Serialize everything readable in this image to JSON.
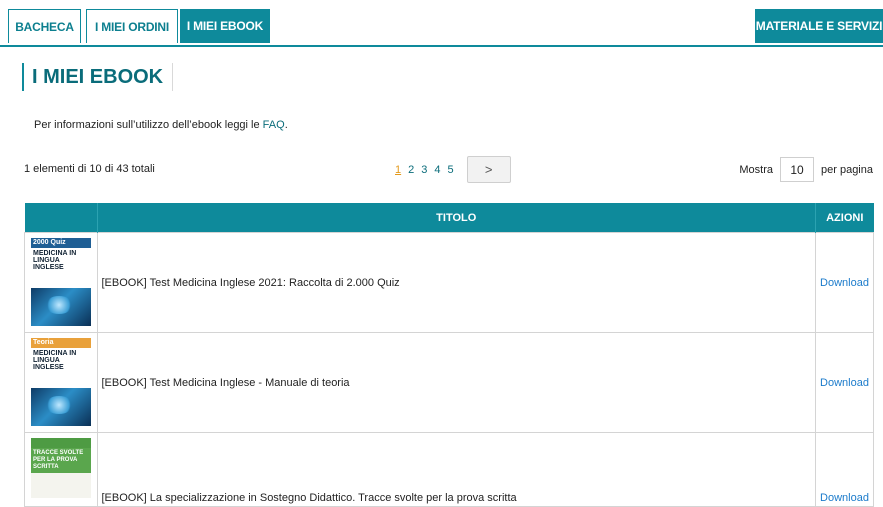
{
  "tabs": [
    {
      "label": "BACHECA"
    },
    {
      "label": "I MIEI ORDINI"
    },
    {
      "label": "I MIEI EBOOK"
    },
    {
      "label": "MATERIALE E SERVIZI"
    }
  ],
  "page_title": "I MIEI EBOOK",
  "info": {
    "text": "Per informazioni sull’utilizzo dell’ebook leggi le ",
    "link": "FAQ",
    "suffix": "."
  },
  "summary": "1 elementi di 10 di 43 totali",
  "pagination": {
    "pages": [
      "1",
      "2",
      "3",
      "4",
      "5"
    ],
    "current": "1",
    "next_glyph": ">"
  },
  "per_page": {
    "label": "Mostra",
    "value": "10",
    "suffix": "per pagina"
  },
  "table": {
    "headers": {
      "image": "",
      "title": "TITOLO",
      "actions": "AZIONI"
    },
    "rows": [
      {
        "title": "[EBOOK] Test Medicina Inglese 2021: Raccolta di 2.000 Quiz",
        "action": "Download",
        "cover": {
          "band": "2000 Quiz",
          "text": "MEDICINA IN LINGUA INGLESE"
        }
      },
      {
        "title": "[EBOOK] Test Medicina Inglese - Manuale di teoria",
        "action": "Download",
        "cover": {
          "band": "Teoria",
          "text": "MEDICINA IN LINGUA INGLESE"
        }
      },
      {
        "title": "[EBOOK] La specializzazione in Sostegno Didattico. Tracce svolte per la prova scritta",
        "action": "Download",
        "cover": {
          "band": "",
          "text": "TRACCE SVOLTE PER LA PROVA SCRITTA"
        }
      }
    ]
  },
  "colors": {
    "accent": "#0e8a9b",
    "link": "#1b7bcb",
    "current_page": "#e39a1c"
  }
}
